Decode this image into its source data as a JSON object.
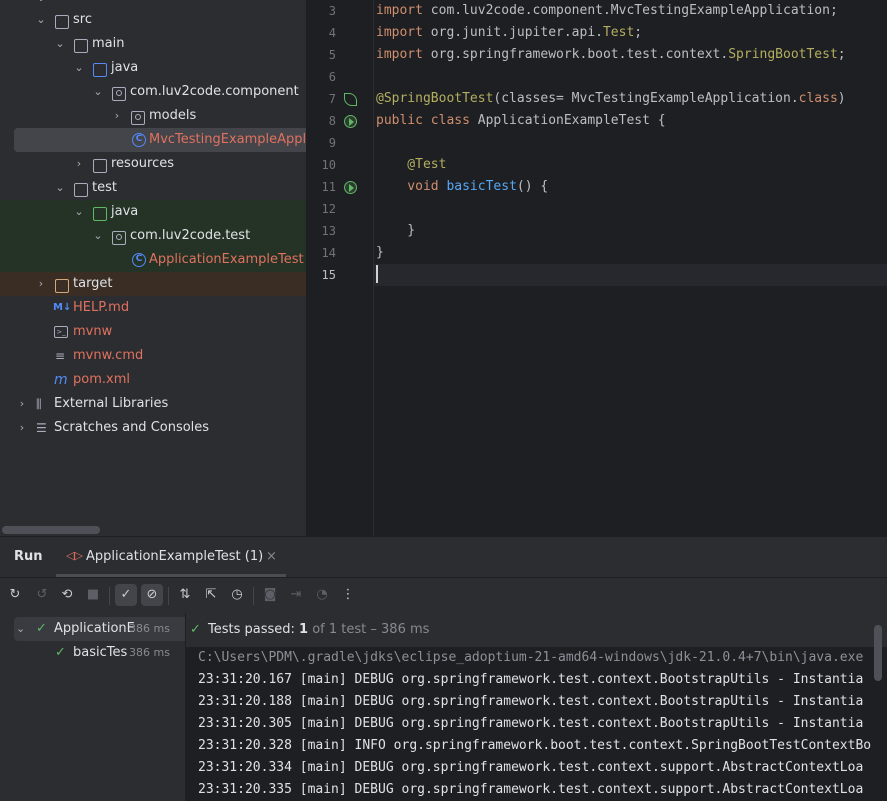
{
  "tree": {
    "items": [
      {
        "label": "src"
      },
      {
        "label": "main"
      },
      {
        "label": "java"
      },
      {
        "label": "com.luv2code.component"
      },
      {
        "label": "models"
      },
      {
        "label": "MvcTestingExampleAppli"
      },
      {
        "label": "resources"
      },
      {
        "label": "test"
      },
      {
        "label": "java"
      },
      {
        "label": "com.luv2code.test"
      },
      {
        "label": "ApplicationExampleTest"
      },
      {
        "label": "target"
      },
      {
        "label": "HELP.md"
      },
      {
        "label": "mvnw"
      },
      {
        "label": "mvnw.cmd"
      },
      {
        "label": "pom.xml"
      },
      {
        "label": "External Libraries"
      },
      {
        "label": "Scratches and Consoles"
      }
    ]
  },
  "editor": {
    "line_numbers": [
      "3",
      "4",
      "5",
      "6",
      "7",
      "8",
      "9",
      "10",
      "11",
      "12",
      "13",
      "14",
      "15"
    ],
    "lines": {
      "l3a": "import ",
      "l3b": "com.luv2code.component.MvcTestingExampleApplication;",
      "l4a": "import ",
      "l4b": "org.junit.jupiter.api.",
      "l4c": "Test",
      "l4d": ";",
      "l5a": "import ",
      "l5b": "org.springframework.boot.test.context.",
      "l5c": "SpringBootTest",
      "l5d": ";",
      "l7a": "@SpringBootTest",
      "l7b": "(classes= MvcTestingExampleApplication.",
      "l7c": "class",
      "l7d": ")",
      "l8a": "public class ",
      "l8b": "ApplicationExampleTest {",
      "l10a": "    @Test",
      "l11a": "    void ",
      "l11b": "basicTest",
      "l11c": "() {",
      "l13a": "    }",
      "l14a": "}"
    }
  },
  "run": {
    "tab_run": "Run",
    "tab_config": "ApplicationExampleTest (1)",
    "status_prefix": "Tests passed: ",
    "status_count": "1",
    "status_suffix": " of 1 test – 386 ms",
    "tests": [
      {
        "label": "ApplicationE",
        "time": "386 ms"
      },
      {
        "label": "basicTes",
        "time": "386 ms"
      }
    ],
    "console": [
      "C:\\Users\\PDM\\.gradle\\jdks\\eclipse_adoptium-21-amd64-windows\\jdk-21.0.4+7\\bin\\java.exe",
      "23:31:20.167 [main] DEBUG org.springframework.test.context.BootstrapUtils - Instantia",
      "23:31:20.188 [main] DEBUG org.springframework.test.context.BootstrapUtils - Instantia",
      "23:31:20.305 [main] DEBUG org.springframework.test.context.BootstrapUtils - Instantia",
      "23:31:20.328 [main] INFO org.springframework.boot.test.context.SpringBootTestContextBo",
      "23:31:20.334 [main] DEBUG org.springframework.test.context.support.AbstractContextLoa",
      "23:31:20.335 [main] DEBUG org.springframework.test.context.support.AbstractContextLoa"
    ]
  }
}
